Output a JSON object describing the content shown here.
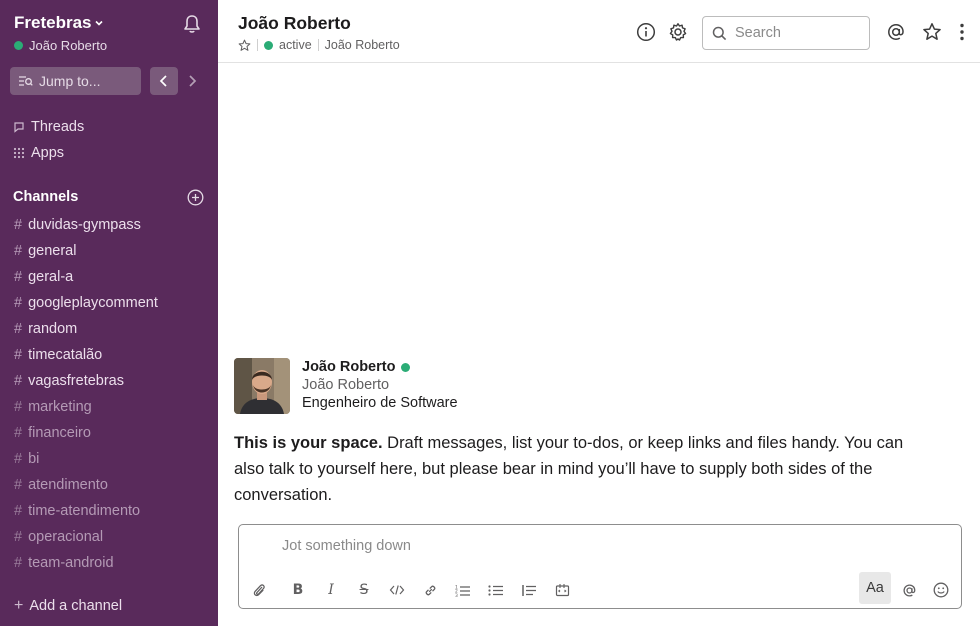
{
  "workspace": {
    "name": "Fretebras",
    "current_user": "João Roberto"
  },
  "sidebar": {
    "jump_label": "Jump to...",
    "threads_label": "Threads",
    "apps_label": "Apps",
    "channels_header": "Channels",
    "channels": [
      {
        "name": "duvidas-gympass",
        "muted": false
      },
      {
        "name": "general",
        "muted": false
      },
      {
        "name": "geral-a",
        "muted": false
      },
      {
        "name": "googleplaycomment",
        "muted": false
      },
      {
        "name": "random",
        "muted": false
      },
      {
        "name": "timecatalão",
        "muted": false
      },
      {
        "name": "vagasfretebras",
        "muted": false
      },
      {
        "name": "marketing",
        "muted": true
      },
      {
        "name": "financeiro",
        "muted": true
      },
      {
        "name": "bi",
        "muted": true
      },
      {
        "name": "atendimento",
        "muted": true
      },
      {
        "name": "time-atendimento",
        "muted": true
      },
      {
        "name": "operacional",
        "muted": true
      },
      {
        "name": "team-android",
        "muted": true
      }
    ],
    "add_channel_label": "Add a channel"
  },
  "header": {
    "title": "João Roberto",
    "status": "active",
    "display_name": "João Roberto",
    "search_placeholder": "Search"
  },
  "profile": {
    "name": "João Roberto",
    "full_name": "João Roberto",
    "title": "Engenheiro de Software"
  },
  "intro": {
    "bold": "This is your space.",
    "text": " Draft messages, list your to-dos, or keep links and files handy. You can also talk to yourself here, but please bear in mind you’ll have to supply both sides of the conversation."
  },
  "composer": {
    "placeholder": "Jot something down",
    "format_label": "Aa"
  },
  "colors": {
    "sidebar": "#592a5b",
    "online": "#2bac76"
  }
}
